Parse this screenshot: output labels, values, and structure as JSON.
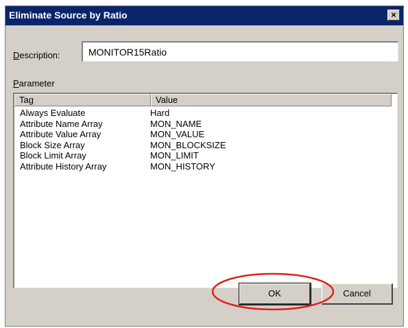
{
  "window": {
    "title": "Eliminate Source by Ratio",
    "close_symbol": "×"
  },
  "description": {
    "label_accel": "D",
    "label_rest": "escription:",
    "value": "MONITOR15Ratio"
  },
  "parameter": {
    "label_accel": "P",
    "label_rest": "arameter"
  },
  "table": {
    "headers": [
      "Tag",
      "Value"
    ],
    "rows": [
      [
        "Always Evaluate",
        "Hard"
      ],
      [
        "Attribute Name Array",
        "MON_NAME"
      ],
      [
        "Attribute Value Array",
        "MON_VALUE"
      ],
      [
        "Block Size Array",
        "MON_BLOCKSIZE"
      ],
      [
        "Block Limit Array",
        "MON_LIMIT"
      ],
      [
        "Attribute History Array",
        "MON_HISTORY"
      ]
    ]
  },
  "buttons": {
    "ok": "OK",
    "cancel": "Cancel"
  },
  "colors": {
    "titlebar": "#0a246a",
    "dialog": "#d4d0c8",
    "highlight": "#e0201d"
  },
  "icons": {
    "close": "close-icon"
  }
}
